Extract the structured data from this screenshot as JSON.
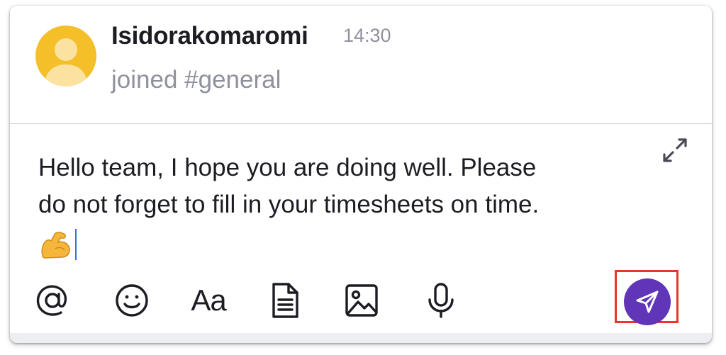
{
  "post": {
    "username": "Isidorakomaromi",
    "timestamp": "14:30",
    "system_message": "joined #general"
  },
  "composer": {
    "lines": [
      "Hello team, I hope you are doing well. Please",
      "do not forget to fill in your timesheets on time."
    ],
    "emoji": "💪"
  },
  "toolbar": {
    "mention_icon": "at-sign-icon",
    "emoji_icon": "smiley-icon",
    "formatting_label": "Aa",
    "attach_icon": "document-icon",
    "image_icon": "image-icon",
    "voice_icon": "microphone-icon",
    "send_icon": "send-paper-plane-icon"
  },
  "colors": {
    "avatar_bg": "#f5bf2a",
    "send_button": "#6035b8",
    "highlight_frame": "#e8362b",
    "muted_text": "#8f919c"
  }
}
